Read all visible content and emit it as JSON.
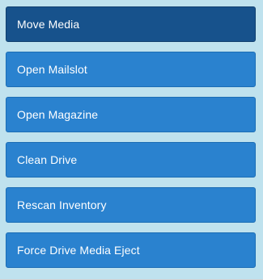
{
  "actions": [
    {
      "label": "Move Media",
      "state": "active"
    },
    {
      "label": "Open Mailslot",
      "state": "normal"
    },
    {
      "label": "Open Magazine",
      "state": "normal"
    },
    {
      "label": "Clean Drive",
      "state": "normal"
    },
    {
      "label": "Rescan Inventory",
      "state": "normal"
    },
    {
      "label": "Force Drive Media Eject",
      "state": "normal"
    }
  ],
  "colors": {
    "panel_background": "#bfe2ee",
    "button_background": "#2a82cf",
    "button_active_background": "#17528c",
    "button_text": "#ffffff"
  }
}
